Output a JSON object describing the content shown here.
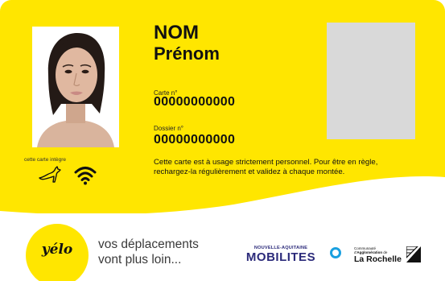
{
  "colors": {
    "brand_yellow": "#ffe600",
    "brand_blue": "#2b2a7a",
    "accent_cyan": "#1aa0e0",
    "placeholder_grey": "#d9d9d9"
  },
  "card": {
    "name": "NOM",
    "first_name": "Prénom",
    "card_number_label": "Carte n°",
    "card_number": "00000000000",
    "file_number_label": "Dossier n°",
    "file_number": "00000000000",
    "usage_notice": "Cette carte est à usage strictement personnel. Pour être en règle, rechargez-la régulièrement et validez à chaque montée.",
    "integrated_label": "cette carte intègre",
    "icons": [
      "kangaroo-icon",
      "contactless-icon"
    ]
  },
  "footer": {
    "brand": "yélo",
    "tagline_line1": "vos déplacements",
    "tagline_line2": "vont plus loin...",
    "partner1_top": "NOUVELLE-AQUITAINE",
    "partner1_bottom": "MOBILITES",
    "partner2_line1": "Communauté",
    "partner2_line2_prefix": "d'",
    "partner2_line2_bold": "Agglomération",
    "partner2_line2_suffix": " de",
    "partner2_line3": "La Rochelle"
  }
}
